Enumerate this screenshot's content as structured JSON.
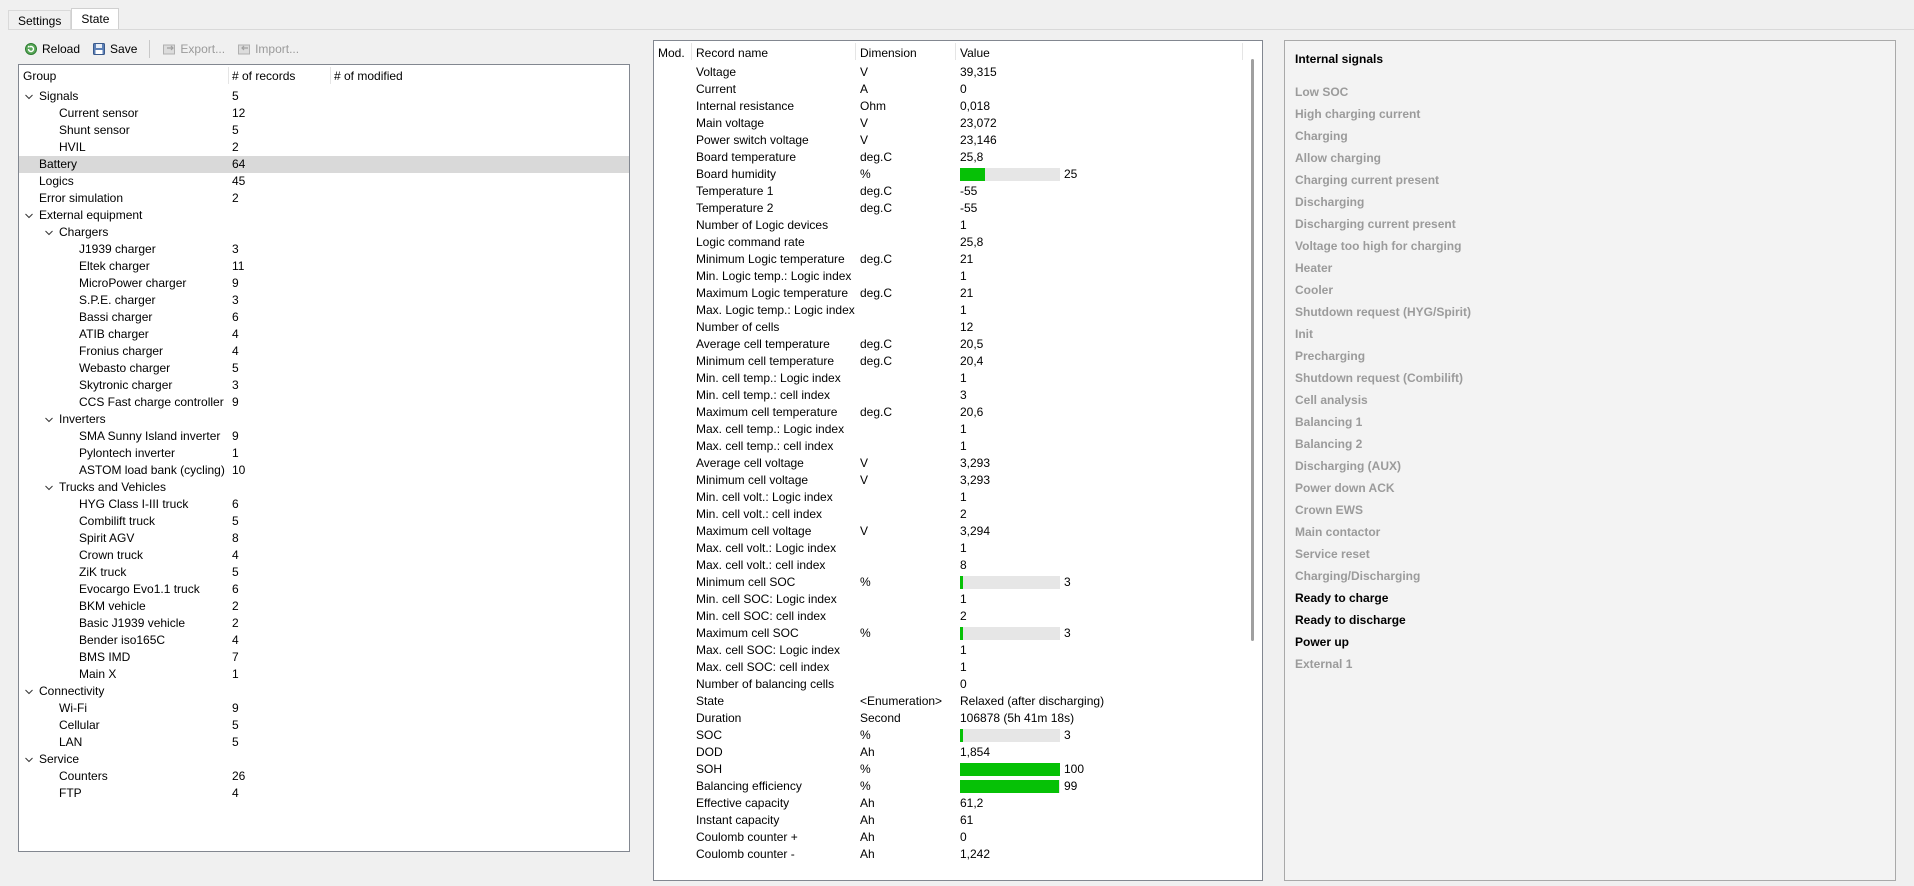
{
  "tabs": [
    "Settings",
    "State"
  ],
  "toolbar": {
    "reload": "Reload",
    "save": "Save",
    "export": "Export...",
    "import": "Import..."
  },
  "tree": {
    "headers": [
      "Group",
      "# of records",
      "# of modified"
    ],
    "rows": [
      {
        "label": "Signals",
        "count": "5",
        "level": 0,
        "expander": true
      },
      {
        "label": "Current sensor",
        "count": "12",
        "level": 1
      },
      {
        "label": "Shunt sensor",
        "count": "5",
        "level": 1
      },
      {
        "label": "HVIL",
        "count": "2",
        "level": 1
      },
      {
        "label": "Battery",
        "count": "64",
        "level": 0,
        "selected": true
      },
      {
        "label": "Logics",
        "count": "45",
        "level": 0
      },
      {
        "label": "Error simulation",
        "count": "2",
        "level": 0
      },
      {
        "label": "External equipment",
        "count": "",
        "level": 0,
        "expander": true
      },
      {
        "label": "Chargers",
        "count": "",
        "level": 1,
        "expander": true
      },
      {
        "label": "J1939 charger",
        "count": "3",
        "level": 2
      },
      {
        "label": "Eltek charger",
        "count": "11",
        "level": 2
      },
      {
        "label": "MicroPower charger",
        "count": "9",
        "level": 2
      },
      {
        "label": "S.P.E. charger",
        "count": "3",
        "level": 2
      },
      {
        "label": "Bassi charger",
        "count": "6",
        "level": 2
      },
      {
        "label": "ATIB charger",
        "count": "4",
        "level": 2
      },
      {
        "label": "Fronius charger",
        "count": "4",
        "level": 2
      },
      {
        "label": "Webasto charger",
        "count": "5",
        "level": 2
      },
      {
        "label": "Skytronic charger",
        "count": "3",
        "level": 2
      },
      {
        "label": "CCS Fast charge controller",
        "count": "9",
        "level": 2
      },
      {
        "label": "Inverters",
        "count": "",
        "level": 1,
        "expander": true
      },
      {
        "label": "SMA Sunny Island inverter",
        "count": "9",
        "level": 2
      },
      {
        "label": "Pylontech inverter",
        "count": "1",
        "level": 2
      },
      {
        "label": "ASTOM load bank (cycling)",
        "count": "10",
        "level": 2
      },
      {
        "label": "Trucks and Vehicles",
        "count": "",
        "level": 1,
        "expander": true
      },
      {
        "label": "HYG Class I-III truck",
        "count": "6",
        "level": 2
      },
      {
        "label": "Combilift truck",
        "count": "5",
        "level": 2
      },
      {
        "label": "Spirit AGV",
        "count": "8",
        "level": 2
      },
      {
        "label": "Crown truck",
        "count": "4",
        "level": 2
      },
      {
        "label": "ZiK truck",
        "count": "5",
        "level": 2
      },
      {
        "label": "Evocargo Evo1.1 truck",
        "count": "6",
        "level": 2
      },
      {
        "label": "BKM vehicle",
        "count": "2",
        "level": 2
      },
      {
        "label": "Basic J1939 vehicle",
        "count": "2",
        "level": 2
      },
      {
        "label": "Bender iso165C",
        "count": "4",
        "level": 2
      },
      {
        "label": "BMS IMD",
        "count": "7",
        "level": 2
      },
      {
        "label": "Main X",
        "count": "1",
        "level": 2
      },
      {
        "label": "Connectivity",
        "count": "",
        "level": 0,
        "expander": true
      },
      {
        "label": "Wi-Fi",
        "count": "9",
        "level": 1
      },
      {
        "label": "Cellular",
        "count": "5",
        "level": 1
      },
      {
        "label": "LAN",
        "count": "5",
        "level": 1
      },
      {
        "label": "Service",
        "count": "",
        "level": 0,
        "expander": true
      },
      {
        "label": "Counters",
        "count": "26",
        "level": 1
      },
      {
        "label": "FTP",
        "count": "4",
        "level": 1
      }
    ]
  },
  "records": {
    "headers": [
      "Mod.",
      "Record name",
      "Dimension",
      "Value"
    ],
    "rows": [
      {
        "name": "Voltage",
        "dim": "V",
        "value": "39,315"
      },
      {
        "name": "Current",
        "dim": "A",
        "value": "0"
      },
      {
        "name": "Internal resistance",
        "dim": "Ohm",
        "value": "0,018"
      },
      {
        "name": "Main voltage",
        "dim": "V",
        "value": "23,072"
      },
      {
        "name": "Power switch voltage",
        "dim": "V",
        "value": "23,146"
      },
      {
        "name": "Board temperature",
        "dim": "deg.C",
        "value": "25,8"
      },
      {
        "name": "Board humidity",
        "dim": "%",
        "value": "25",
        "bar": 25
      },
      {
        "name": "Temperature 1",
        "dim": "deg.C",
        "value": "-55"
      },
      {
        "name": "Temperature 2",
        "dim": "deg.C",
        "value": "-55"
      },
      {
        "name": "Number of Logic devices",
        "dim": "",
        "value": "1"
      },
      {
        "name": "Logic command rate",
        "dim": "",
        "value": "25,8"
      },
      {
        "name": "Minimum Logic temperature",
        "dim": "deg.C",
        "value": "21"
      },
      {
        "name": "Min. Logic temp.: Logic index",
        "dim": "",
        "value": "1"
      },
      {
        "name": "Maximum Logic temperature",
        "dim": "deg.C",
        "value": "21"
      },
      {
        "name": "Max. Logic temp.: Logic index",
        "dim": "",
        "value": "1"
      },
      {
        "name": "Number of cells",
        "dim": "",
        "value": "12"
      },
      {
        "name": "Average cell temperature",
        "dim": "deg.C",
        "value": "20,5"
      },
      {
        "name": "Minimum cell temperature",
        "dim": "deg.C",
        "value": "20,4"
      },
      {
        "name": "Min. cell temp.: Logic index",
        "dim": "",
        "value": "1"
      },
      {
        "name": "Min. cell temp.: cell index",
        "dim": "",
        "value": "3"
      },
      {
        "name": "Maximum cell temperature",
        "dim": "deg.C",
        "value": "20,6"
      },
      {
        "name": "Max. cell temp.: Logic index",
        "dim": "",
        "value": "1"
      },
      {
        "name": "Max. cell temp.: cell index",
        "dim": "",
        "value": "1"
      },
      {
        "name": "Average cell voltage",
        "dim": "V",
        "value": "3,293"
      },
      {
        "name": "Minimum cell voltage",
        "dim": "V",
        "value": "3,293"
      },
      {
        "name": "Min. cell volt.: Logic index",
        "dim": "",
        "value": "1"
      },
      {
        "name": "Min. cell volt.: cell index",
        "dim": "",
        "value": "2"
      },
      {
        "name": "Maximum cell voltage",
        "dim": "V",
        "value": "3,294"
      },
      {
        "name": "Max. cell volt.: Logic index",
        "dim": "",
        "value": "1"
      },
      {
        "name": "Max. cell volt.: cell index",
        "dim": "",
        "value": "8"
      },
      {
        "name": "Minimum cell SOC",
        "dim": "%",
        "value": "3",
        "bar": 3
      },
      {
        "name": "Min. cell SOC: Logic index",
        "dim": "",
        "value": "1"
      },
      {
        "name": "Min. cell SOC: cell index",
        "dim": "",
        "value": "2"
      },
      {
        "name": "Maximum cell SOC",
        "dim": "%",
        "value": "3",
        "bar": 3
      },
      {
        "name": "Max. cell SOC: Logic index",
        "dim": "",
        "value": "1"
      },
      {
        "name": "Max. cell SOC: cell index",
        "dim": "",
        "value": "1"
      },
      {
        "name": "Number of balancing cells",
        "dim": "",
        "value": "0"
      },
      {
        "name": "State",
        "dim": "<Enumeration>",
        "value": "Relaxed (after discharging)"
      },
      {
        "name": "Duration",
        "dim": "Second",
        "value": "106878 (5h 41m 18s)"
      },
      {
        "name": "SOC",
        "dim": "%",
        "value": "3",
        "bar": 3
      },
      {
        "name": "DOD",
        "dim": "Ah",
        "value": "1,854"
      },
      {
        "name": "SOH",
        "dim": "%",
        "value": "100",
        "bar": 100
      },
      {
        "name": "Balancing efficiency",
        "dim": "%",
        "value": "99",
        "bar": 99
      },
      {
        "name": "Effective capacity",
        "dim": "Ah",
        "value": "61,2"
      },
      {
        "name": "Instant capacity",
        "dim": "Ah",
        "value": "61"
      },
      {
        "name": "Coulomb counter +",
        "dim": "Ah",
        "value": "0"
      },
      {
        "name": "Coulomb counter -",
        "dim": "Ah",
        "value": "1,242"
      }
    ]
  },
  "signals": {
    "title": "Internal signals",
    "items": [
      {
        "label": "Low SOC",
        "active": false
      },
      {
        "label": "High charging current",
        "active": false
      },
      {
        "label": "Charging",
        "active": false
      },
      {
        "label": "Allow charging",
        "active": false
      },
      {
        "label": "Charging current present",
        "active": false
      },
      {
        "label": "Discharging",
        "active": false
      },
      {
        "label": "Discharging current present",
        "active": false
      },
      {
        "label": "Voltage too high for charging",
        "active": false
      },
      {
        "label": "Heater",
        "active": false
      },
      {
        "label": "Cooler",
        "active": false
      },
      {
        "label": "Shutdown request (HYG/Spirit)",
        "active": false
      },
      {
        "label": "Init",
        "active": false
      },
      {
        "label": "Precharging",
        "active": false
      },
      {
        "label": "Shutdown request (Combilift)",
        "active": false
      },
      {
        "label": "Cell analysis",
        "active": false
      },
      {
        "label": "Balancing 1",
        "active": false
      },
      {
        "label": "Balancing 2",
        "active": false
      },
      {
        "label": "Discharging (AUX)",
        "active": false
      },
      {
        "label": "Power down ACK",
        "active": false
      },
      {
        "label": "Crown EWS",
        "active": false
      },
      {
        "label": "Main contactor",
        "active": false
      },
      {
        "label": "Service reset",
        "active": false
      },
      {
        "label": "Charging/Discharging",
        "active": false
      },
      {
        "label": "Ready to charge",
        "active": true
      },
      {
        "label": "Ready to discharge",
        "active": true
      },
      {
        "label": "Power up",
        "active": true
      },
      {
        "label": "External 1",
        "active": false
      }
    ]
  },
  "colors": {
    "bar_fill": "#06c106",
    "bar_track": "#e6e6e6",
    "selected_row": "#d9d9d9",
    "inactive_signal": "#9b9b9b"
  }
}
